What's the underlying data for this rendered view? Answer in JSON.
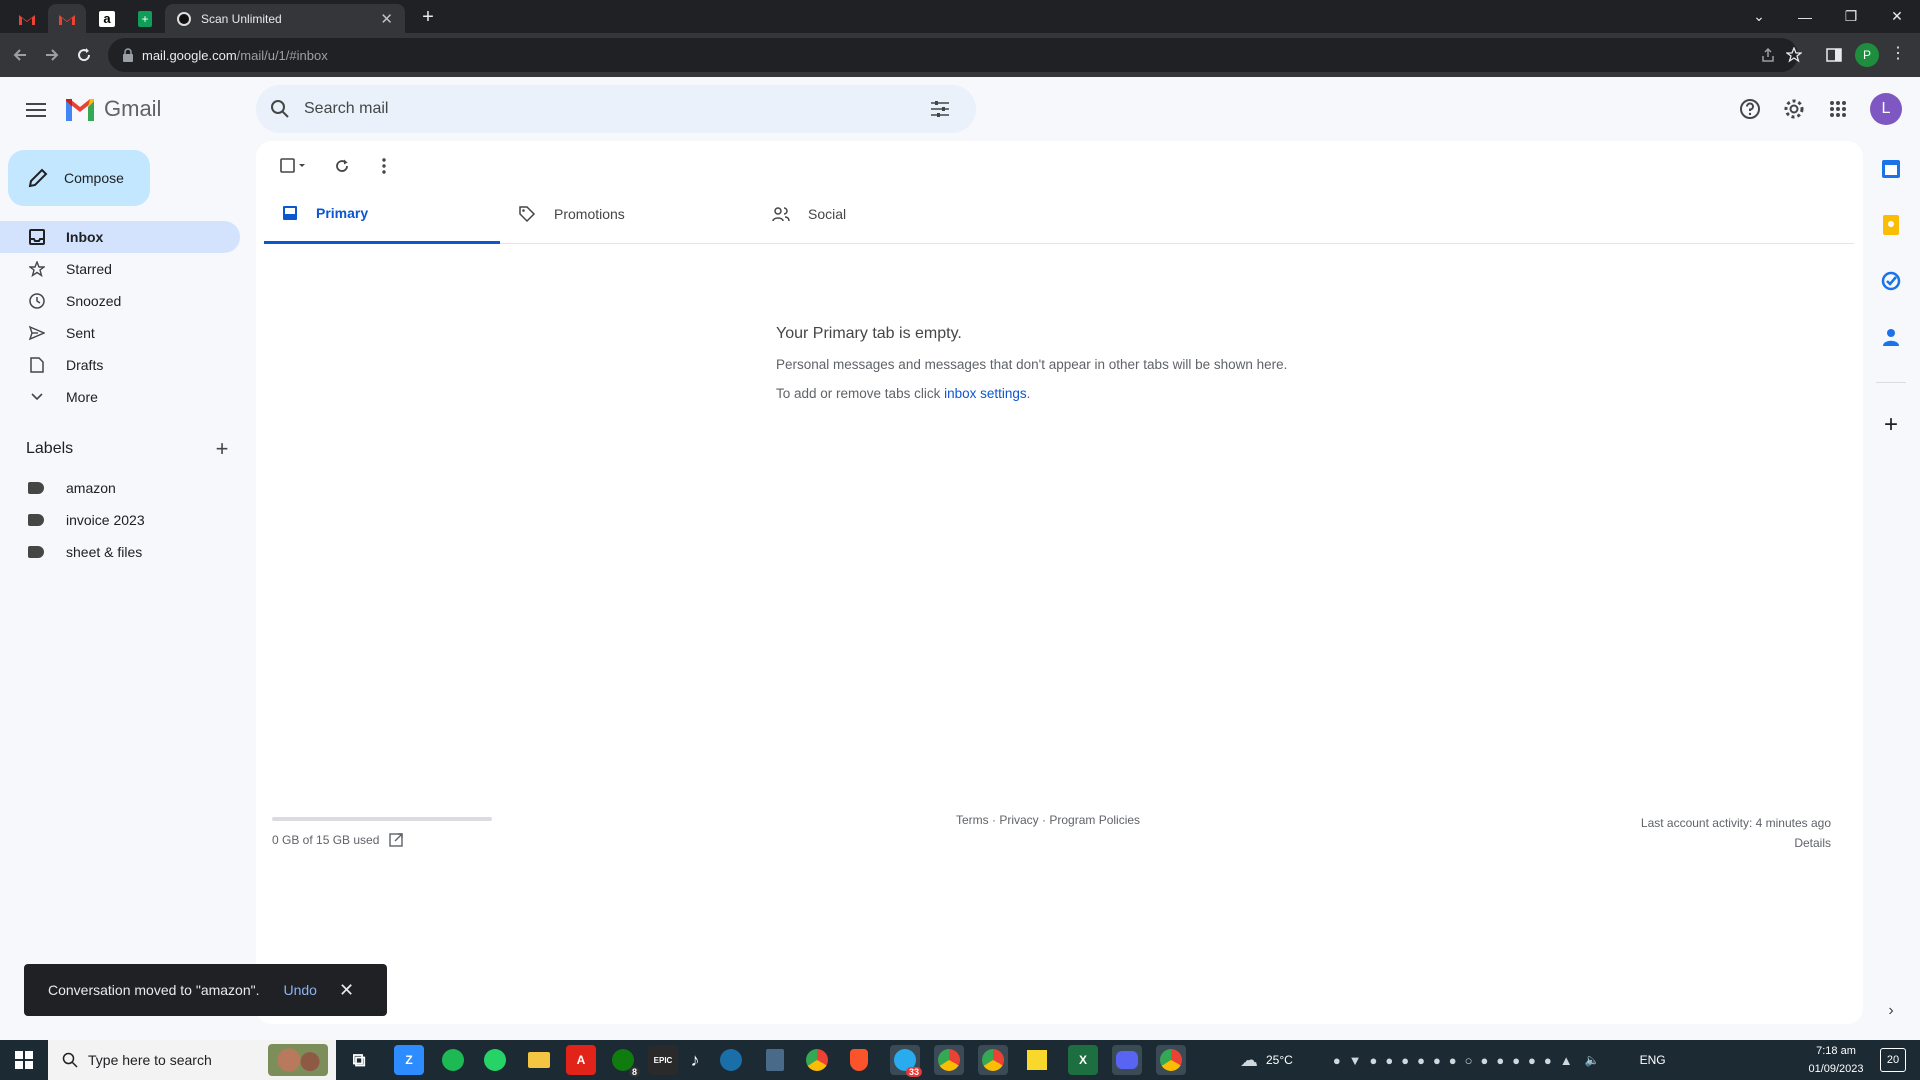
{
  "browser": {
    "tab_title": "Scan Unlimited",
    "url_host": "mail.google.com",
    "url_path": "/mail/u/1/#inbox",
    "profile_initial": "P"
  },
  "gmail": {
    "logo_text": "Gmail",
    "search_placeholder": "Search mail",
    "avatar_initial": "L",
    "compose_label": "Compose",
    "nav": [
      {
        "label": "Inbox"
      },
      {
        "label": "Starred"
      },
      {
        "label": "Snoozed"
      },
      {
        "label": "Sent"
      },
      {
        "label": "Drafts"
      },
      {
        "label": "More"
      }
    ],
    "labels_heading": "Labels",
    "labels": [
      "amazon",
      "invoice 2023",
      "sheet & files"
    ],
    "tabs": [
      {
        "label": "Primary"
      },
      {
        "label": "Promotions"
      },
      {
        "label": "Social"
      }
    ],
    "empty_title": "Your Primary tab is empty.",
    "empty_line1": "Personal messages and messages that don't appear in other tabs will be shown here.",
    "empty_line2_prefix": "To add or remove tabs click ",
    "empty_line2_link": "inbox settings",
    "empty_line2_suffix": ".",
    "storage_used": 0,
    "storage_text": "0 GB of 15 GB used",
    "footer": {
      "terms": "Terms",
      "privacy": "Privacy",
      "policies": "Program Policies",
      "sep": " · "
    },
    "activity_line": "Last account activity: 4 minutes ago",
    "details_link": "Details",
    "toast_text": "Conversation moved to \"amazon\".",
    "toast_undo": "Undo"
  },
  "taskbar": {
    "search_placeholder": "Type here to search",
    "temperature": "25°C",
    "language": "ENG",
    "time": "7:18 am",
    "date": "01/09/2023",
    "notifications": "20",
    "xbox_badge": "8",
    "telegram_badge": "33"
  }
}
